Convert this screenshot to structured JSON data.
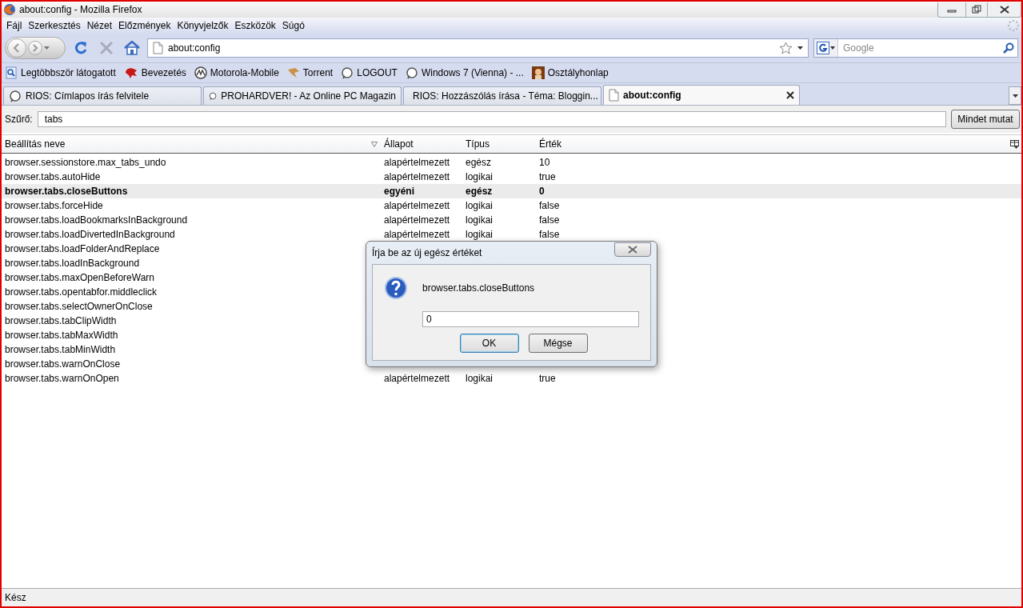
{
  "window": {
    "title": "about:config - Mozilla Firefox"
  },
  "menu": [
    "Fájl",
    "Szerkesztés",
    "Nézet",
    "Előzmények",
    "Könyvjelzők",
    "Eszközök",
    "Súgó"
  ],
  "navbar": {
    "url": "about:config",
    "search_placeholder": "Google"
  },
  "bookmarks": [
    {
      "label": "Legtöbbször látogatott",
      "kind": "smart"
    },
    {
      "label": "Bevezetés",
      "kind": "red"
    },
    {
      "label": "Motorola-Mobile",
      "kind": "moto"
    },
    {
      "label": "Torrent",
      "kind": "torrent"
    },
    {
      "label": "LOGOUT",
      "kind": "generic"
    },
    {
      "label": "Windows 7 (Vienna) - ...",
      "kind": "generic"
    },
    {
      "label": "Osztályhonlap",
      "kind": "photo"
    }
  ],
  "tabs": [
    {
      "label": "RIOS: Címlapos írás felvitele",
      "selected": false,
      "kind": "site"
    },
    {
      "label": "PROHARDVER! - Az Online PC Magazin",
      "selected": false,
      "kind": "site"
    },
    {
      "label": "RIOS: Hozzászólás írása - Téma: Bloggin...",
      "selected": false,
      "kind": "site"
    },
    {
      "label": "about:config",
      "selected": true,
      "kind": "page"
    }
  ],
  "filter": {
    "label": "Szűrő:",
    "value": "tabs",
    "button": "Mindet mutat"
  },
  "table": {
    "columns": [
      "Beállítás neve",
      "Állapot",
      "Típus",
      "Érték"
    ],
    "rows": [
      {
        "name": "browser.sessionstore.max_tabs_undo",
        "status": "alapértelmezett",
        "type": "egész",
        "value": "10",
        "modified": false,
        "selected": false
      },
      {
        "name": "browser.tabs.autoHide",
        "status": "alapértelmezett",
        "type": "logikai",
        "value": "true",
        "modified": false,
        "selected": false
      },
      {
        "name": "browser.tabs.closeButtons",
        "status": "egyéni",
        "type": "egész",
        "value": "0",
        "modified": true,
        "selected": true
      },
      {
        "name": "browser.tabs.forceHide",
        "status": "alapértelmezett",
        "type": "logikai",
        "value": "false",
        "modified": false,
        "selected": false
      },
      {
        "name": "browser.tabs.loadBookmarksInBackground",
        "status": "alapértelmezett",
        "type": "logikai",
        "value": "false",
        "modified": false,
        "selected": false
      },
      {
        "name": "browser.tabs.loadDivertedInBackground",
        "status": "alapértelmezett",
        "type": "logikai",
        "value": "false",
        "modified": false,
        "selected": false
      },
      {
        "name": "browser.tabs.loadFolderAndReplace",
        "modified": false,
        "selected": false
      },
      {
        "name": "browser.tabs.loadInBackground",
        "modified": false,
        "selected": false
      },
      {
        "name": "browser.tabs.maxOpenBeforeWarn",
        "modified": false,
        "selected": false
      },
      {
        "name": "browser.tabs.opentabfor.middleclick",
        "modified": false,
        "selected": false
      },
      {
        "name": "browser.tabs.selectOwnerOnClose",
        "modified": false,
        "selected": false
      },
      {
        "name": "browser.tabs.tabClipWidth",
        "modified": false,
        "selected": false
      },
      {
        "name": "browser.tabs.tabMaxWidth",
        "modified": false,
        "selected": false
      },
      {
        "name": "browser.tabs.tabMinWidth",
        "modified": false,
        "selected": false
      },
      {
        "name": "browser.tabs.warnOnClose",
        "modified": false,
        "selected": false
      },
      {
        "name": "browser.tabs.warnOnOpen",
        "status": "alapértelmezett",
        "type": "logikai",
        "value": "true",
        "modified": false,
        "selected": false
      }
    ]
  },
  "dialog": {
    "title": "Írja be az új egész értéket",
    "message": "browser.tabs.closeButtons",
    "value": "0",
    "buttons": [
      {
        "label": "OK",
        "default": true
      },
      {
        "label": "Mégse",
        "default": false
      }
    ]
  },
  "status_bar": "Kész"
}
